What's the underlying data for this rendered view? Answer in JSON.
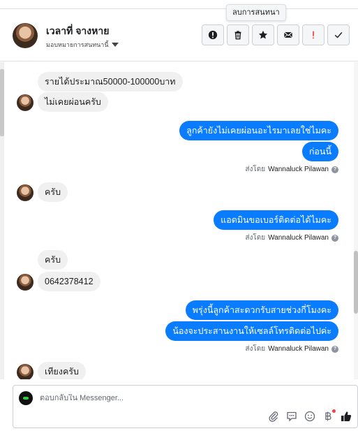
{
  "tooltip": "ลบการสนทนา",
  "header": {
    "name": "เวลาที่ จางหาย",
    "assign_label": "มอบหมายการสนทนานี้"
  },
  "actions": [
    {
      "icon": "exclamation-circle-icon"
    },
    {
      "icon": "trash-icon"
    },
    {
      "icon": "star-icon"
    },
    {
      "icon": "envelope-icon"
    },
    {
      "icon": "spam-icon"
    },
    {
      "icon": "checkmark-icon"
    }
  ],
  "messages": {
    "m1": "รายได้ประมาณ50000-100000บาท",
    "m2": "ไม่เคยผ่อนครับ",
    "m3": "ลูกค้ายังไม่เคยผ่อนอะไรมาเลยใช่ไมคะ",
    "m4": "ก่อนนี้",
    "m5": "ครับ",
    "m6": "แอดมินขอเบอร์ติดต่อได้ไมคะ",
    "m7": "ครับ",
    "m8": "0642378412",
    "m9": "พรุ่งนี้ลูกค้าสะดวกรับสายช่วงกี่โมงคะ",
    "m10": "น้องจะประสานงานให้เซลล์โทรติดต่อไปค่ะ",
    "m11": "เทียงครับ"
  },
  "sent_by": {
    "prefix": "ส่งโดย",
    "agent": "Wannaluck Pilawan"
  },
  "composer": {
    "placeholder": "ตอบกลับใน Messenger..."
  },
  "colors": {
    "outgoing": "#0a7cff",
    "incoming": "#f0f0f0",
    "spam_red": "#fa3e3e"
  }
}
